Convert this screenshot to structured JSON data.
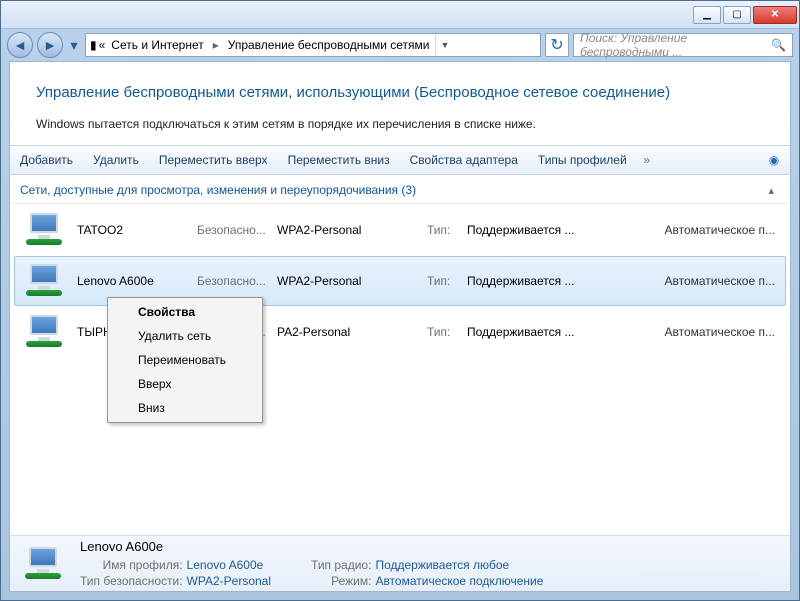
{
  "breadcrumb": {
    "b1": "Сеть и Интернет",
    "b2": "Управление беспроводными сетями"
  },
  "search": {
    "placeholder": "Поиск: Управление беспроводными ..."
  },
  "heading": "Управление беспроводными сетями, использующими (Беспроводное сетевое соединение)",
  "description": "Windows пытается подключаться к этим сетям в порядке их перечисления в списке ниже.",
  "toolbar": {
    "add": "Добавить",
    "del": "Удалить",
    "up": "Переместить вверх",
    "down": "Переместить вниз",
    "adapter": "Свойства адаптера",
    "profiles": "Типы профилей"
  },
  "group_header": "Сети, доступные для просмотра, изменения и переупорядочивания (3)",
  "column_labels": {
    "sec": "Безопасно...",
    "type": "Тип:"
  },
  "networks": [
    {
      "name": "TATOO2",
      "sec": "WPA2-Personal",
      "type": "Поддерживается ...",
      "auto": "Автоматическое п..."
    },
    {
      "name": "Lenovo A600e",
      "sec": "WPA2-Personal",
      "type": "Поддерживается ...",
      "auto": "Автоматическое п..."
    },
    {
      "name": "ТЫРН",
      "sec": "PA2-Personal",
      "type": "Поддерживается ...",
      "auto": "Автоматическое п..."
    }
  ],
  "context_menu": {
    "props": "Свойства",
    "delete": "Удалить сеть",
    "rename": "Переименовать",
    "up": "Вверх",
    "down": "Вниз"
  },
  "details": {
    "title": "Lenovo A600e",
    "profile_lbl": "Имя профиля:",
    "profile_val": "Lenovo A600e",
    "sec_lbl": "Тип безопасности:",
    "sec_val": "WPA2-Personal",
    "radio_lbl": "Тип радио:",
    "radio_val": "Поддерживается любое",
    "mode_lbl": "Режим:",
    "mode_val": "Автоматическое подключение"
  }
}
